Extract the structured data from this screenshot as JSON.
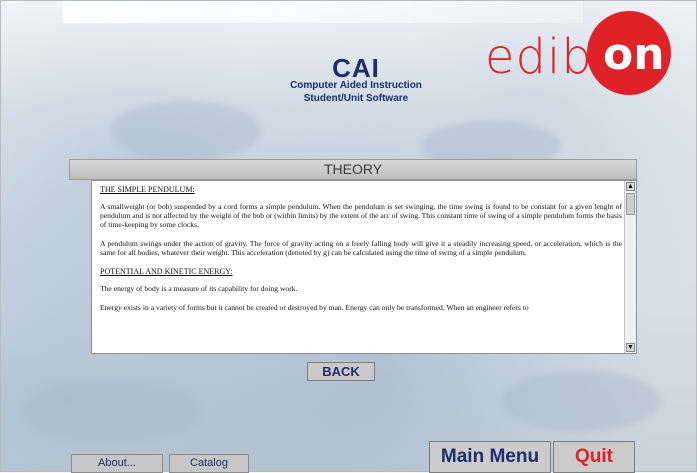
{
  "header": {
    "title": "CAI",
    "subtitle_line1": "Computer Aided Instruction",
    "subtitle_line2": "Student/Unit Software",
    "logo_text": "edib",
    "logo_circle_text": "on"
  },
  "section": {
    "title": "THEORY"
  },
  "document": {
    "heading1": "THE SIMPLE PENDULUM:",
    "para1": "A smallweight (or bob) suspended by a cord forms a simple pendulum. When the pendulum is set swinging, the time swing is found to be constant for a given lenght of pendulum and is not affected by the weight of the bob or (within limits) by the extent of the arc of swing. This constant time of swing of a simple pendulum forms the basis of time-keeping by some clocks.",
    "para2": "A pendulum swings under the action of gravity. The force of gravity acting on a freely falling body will give it a steadily increasing speed, or acceleration, which is the same for all bodies, whatever their weight. This acceleration (denoted by g) can be calculated using the time of swing of a simple pendulum.",
    "heading2": "POTENTIAL AND KINETIC ENERGY:",
    "para3": "The energy of body is a measure of its capability for doing work.",
    "para4": "Energy exists in a variety of forms but it cannot be created or destroyed by man. Energy can only be transformed. When an engineer refers to"
  },
  "buttons": {
    "back": "BACK",
    "about": "About...",
    "catalog": "Catalog",
    "main_menu": "Main Menu",
    "quit": "Quit"
  },
  "colors": {
    "brand_red": "#e02228",
    "navy": "#1d2f6b",
    "button_gray": "#c9c9c9"
  }
}
